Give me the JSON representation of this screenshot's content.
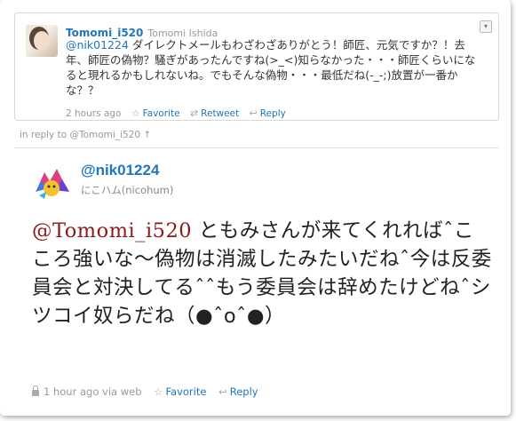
{
  "parent_tweet": {
    "screen_name": "Tomomi_i520",
    "real_name": "Tomomi Ishida",
    "mention": "@nik01224",
    "text_rest": " ダイレクトメールもわざわざありがとう！師匠、元気ですか？！去年、師匠の偽物？騒ぎがあったんですね(>_<)知らなかった・・・師匠くらいになると現れるかもしれないね。でもそんな偽物・・・最低だね(-_-;)放置が一番かな？？",
    "time": "2 hours ago",
    "favorite_label": "Favorite",
    "retweet_label": "Retweet",
    "reply_label": "Reply"
  },
  "in_reply_to": "in reply to @Tomomi_i520 ↑",
  "main_tweet": {
    "screen_name": "@nik01224",
    "real_name": "にこハム(nicohum)",
    "mention": "@Tomomi_i520",
    "text_rest": " ともみさんが来てくれればˆこころ強いな〜偽物は消滅したみたいだねˆ今は反委員会と対決してるˆˆもう委員会は辞めたけどねˆシツコイ奴らだね（●ˆoˆ●）",
    "time": "1 hour ago via web",
    "favorite_label": "Favorite",
    "reply_label": "Reply"
  },
  "icons": {
    "favorite": "star-icon",
    "retweet": "retweet-icon",
    "reply": "reply-icon",
    "lock": "lock-icon"
  },
  "colors": {
    "link": "#2276bb",
    "mention_large": "#8b1a1a",
    "meta": "#999999"
  }
}
